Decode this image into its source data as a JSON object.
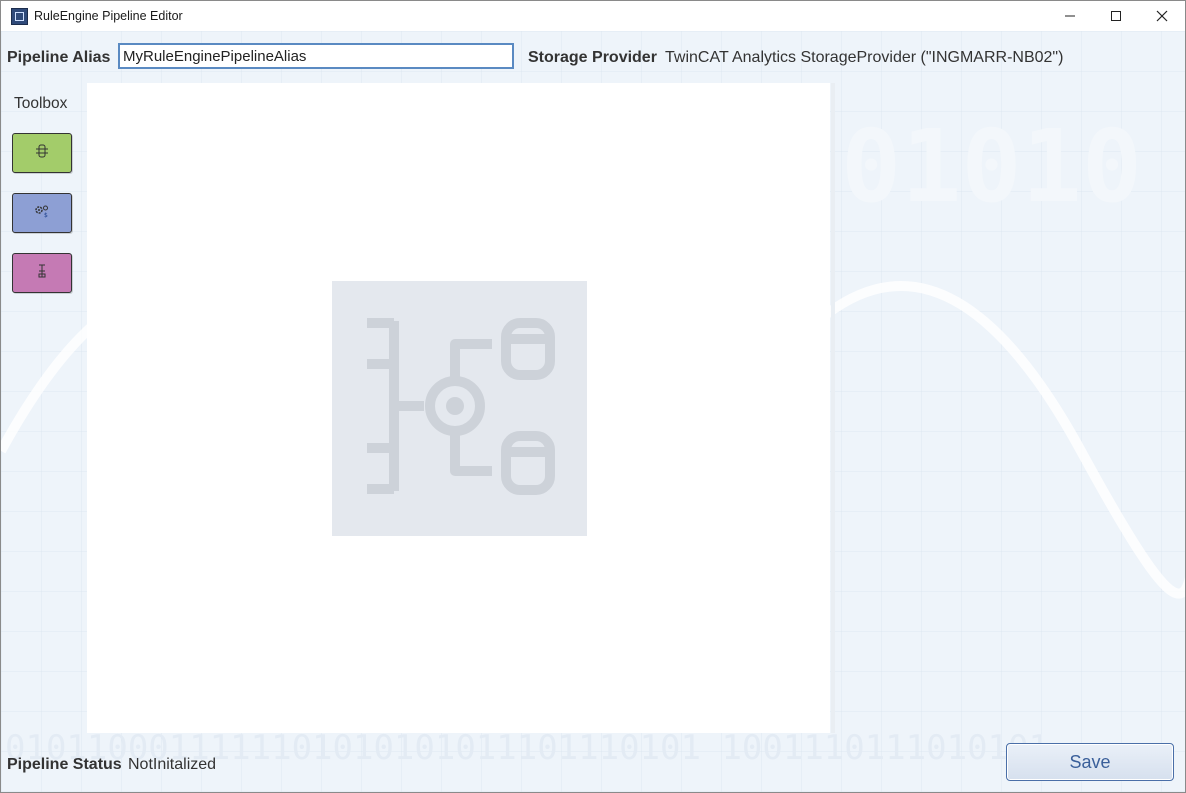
{
  "window": {
    "title": "RuleEngine Pipeline Editor",
    "controls": {
      "minimize": "minimize-icon",
      "maximize": "maximize-icon",
      "close": "close-icon"
    }
  },
  "header": {
    "alias_label": "Pipeline Alias",
    "alias_value": "MyRuleEnginePipelineAlias",
    "storage_label": "Storage Provider",
    "storage_value": "TwinCAT Analytics StorageProvider (\"INGMARR-NB02\")"
  },
  "toolbox": {
    "label": "Toolbox",
    "items": [
      {
        "icon": "input-module-icon",
        "color": "#a3cc6a"
      },
      {
        "icon": "rules-gear-icon",
        "color": "#8d9fd4"
      },
      {
        "icon": "output-module-icon",
        "color": "#c57ab4"
      }
    ]
  },
  "canvas": {
    "placeholder_icon": "pipeline-placeholder-icon"
  },
  "footer": {
    "status_label": "Pipeline Status",
    "status_value": "NotInitalized",
    "save_label": "Save",
    "background_digits": "0101100011111101010101011101110101 1001110111010101"
  },
  "colors": {
    "accent": "#5a8ac2",
    "save_text": "#3a5f9a",
    "window_bg": "#eef4fa"
  }
}
